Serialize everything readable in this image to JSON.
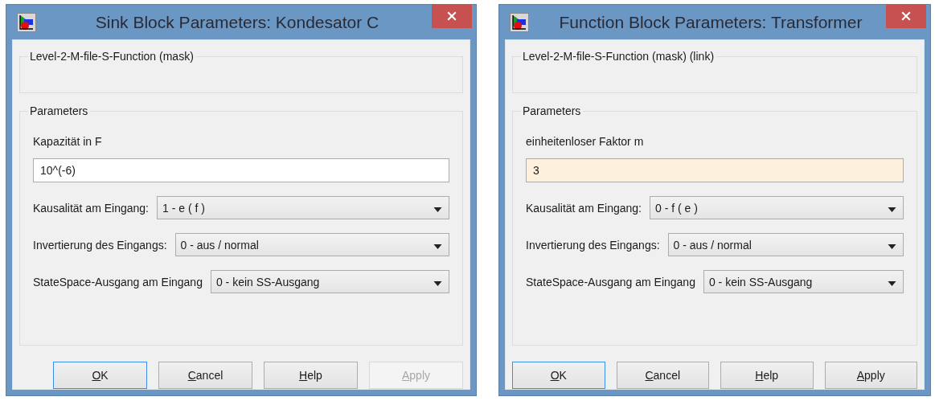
{
  "dialogs": [
    {
      "title": "Sink Block Parameters: Kondesator C",
      "description_group": "Level-2-M-file-S-Function (mask)",
      "parameters_group": "Parameters",
      "field": {
        "label": "Kapazität in F",
        "value": "10^(-6)",
        "modified": false
      },
      "dropdowns": [
        {
          "label": "Kausalität am Eingang:",
          "value": "1 - e ( f )"
        },
        {
          "label": "Invertierung des Eingangs:",
          "value": "0 - aus / normal"
        },
        {
          "label": "StateSpace-Ausgang am Eingang",
          "value": "0 - kein SS-Ausgang"
        }
      ],
      "buttons": [
        {
          "label": "OK",
          "default": true,
          "disabled": false
        },
        {
          "label": "Cancel",
          "default": false,
          "disabled": false
        },
        {
          "label": "Help",
          "default": false,
          "disabled": false
        },
        {
          "label": "Apply",
          "default": false,
          "disabled": true
        }
      ]
    },
    {
      "title": "Function Block Parameters: Transformer",
      "description_group": "Level-2-M-file-S-Function (mask) (link)",
      "parameters_group": "Parameters",
      "field": {
        "label": "einheitenloser Faktor m",
        "value": "3",
        "modified": true
      },
      "dropdowns": [
        {
          "label": "Kausalität am Eingang:",
          "value": "0 - f ( e )"
        },
        {
          "label": "Invertierung des Eingangs:",
          "value": "0 - aus / normal"
        },
        {
          "label": "StateSpace-Ausgang am Eingang",
          "value": "0 - kein SS-Ausgang"
        }
      ],
      "buttons": [
        {
          "label": "OK",
          "default": true,
          "disabled": false
        },
        {
          "label": "Cancel",
          "default": false,
          "disabled": false
        },
        {
          "label": "Help",
          "default": false,
          "disabled": false
        },
        {
          "label": "Apply",
          "default": false,
          "disabled": false
        }
      ]
    }
  ]
}
